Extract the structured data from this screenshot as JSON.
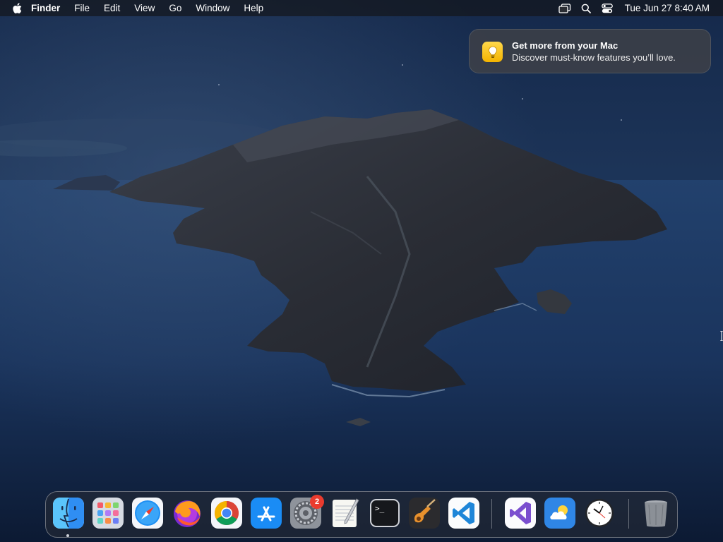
{
  "menubar": {
    "app_name": "Finder",
    "menus": [
      "File",
      "Edit",
      "View",
      "Go",
      "Window",
      "Help"
    ],
    "status_icons": [
      "screen-mirroring-icon",
      "search-icon",
      "control-center-icon"
    ],
    "clock": "Tue Jun 27  8:40 AM"
  },
  "notification": {
    "title": "Get more from your Mac",
    "body": "Discover must-know features you’ll love.",
    "icon": "lightbulb-icon"
  },
  "dock": {
    "apps": [
      {
        "name": "Finder",
        "icon": "finder-icon",
        "running": true
      },
      {
        "name": "Launchpad",
        "icon": "launchpad-icon"
      },
      {
        "name": "Safari",
        "icon": "safari-icon"
      },
      {
        "name": "Firefox",
        "icon": "firefox-icon"
      },
      {
        "name": "Chrome",
        "icon": "chrome-icon"
      },
      {
        "name": "App Store",
        "icon": "app-store-icon"
      },
      {
        "name": "System Settings",
        "icon": "system-settings-icon",
        "badge": "2"
      },
      {
        "name": "TextEdit",
        "icon": "textedit-icon"
      },
      {
        "name": "Terminal",
        "icon": "terminal-icon"
      },
      {
        "name": "GarageBand",
        "icon": "garageband-icon"
      },
      {
        "name": "Visual Studio Code",
        "icon": "vscode-icon"
      },
      {
        "name": "Visual Studio",
        "icon": "visual-studio-icon"
      },
      {
        "name": "Weather",
        "icon": "weather-icon"
      },
      {
        "name": "Clock",
        "icon": "clock-icon"
      },
      {
        "name": "Trash",
        "icon": "trash-icon"
      }
    ]
  },
  "colors": {
    "accent_badge": "#ea3b2e",
    "notification_bg": "#3c4048",
    "wallpaper_sea": "#1b3560"
  }
}
